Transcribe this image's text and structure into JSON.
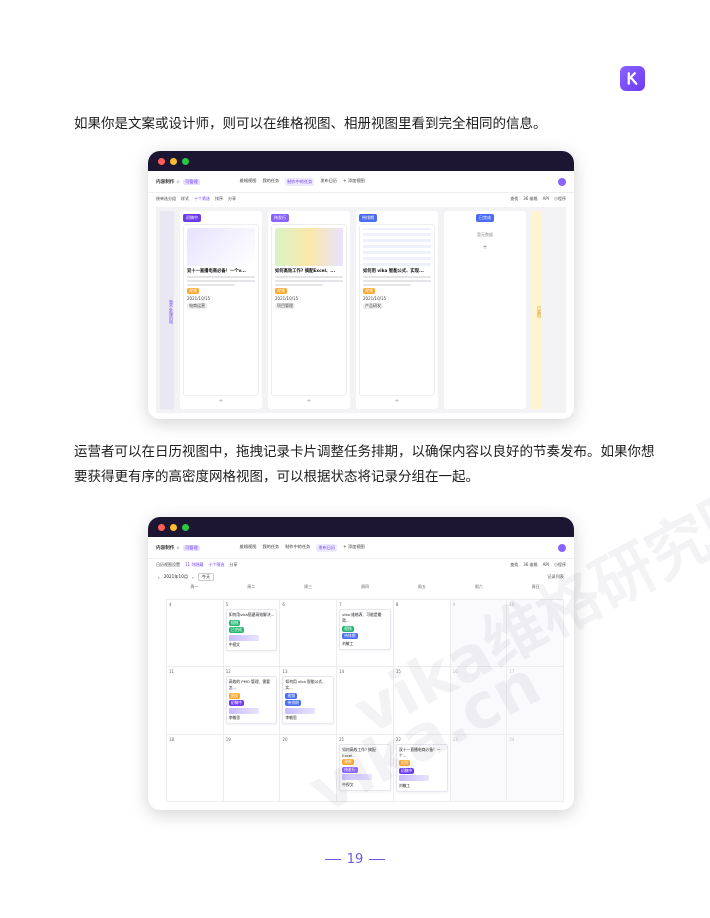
{
  "paragraphs": {
    "p1": "如果你是文案或设计师，则可以在维格视图、相册视图里看到完全相同的信息。",
    "p2": "运营者可以在日历视图中，拖拽记录卡片调整任务排期，以确保内容以良好的节奏发布。如果你想要获得更有序的高密度网格视图，可以根据状态将记录分组在一起。"
  },
  "watermark": "vika维格研究院",
  "watermark_url": "vika.cn",
  "app": {
    "name": "内容制作 ☆",
    "badge": "可管理",
    "tabs1": [
      "维格视图",
      "我的任务",
      "制作中的任务",
      "发布日历",
      "+ 添加视图"
    ],
    "tabs2": [
      "维格视图",
      "我的任务",
      "制作中的任务",
      "发布日历",
      "+ 添加视图"
    ],
    "right": [
      "查找",
      "36 维格",
      "API",
      "小程序"
    ]
  },
  "toolbar1": [
    "按单选分组",
    "样式",
    "十个筛选",
    "排序",
    "分享"
  ],
  "toolbar2": [
    "日历视图设置",
    "11 列隐藏",
    "十个筛选",
    "分享"
  ],
  "kanban": {
    "left_label": "暂不处理的项",
    "columns": [
      {
        "chip": "初稿中",
        "color": "#6b3bf2",
        "title": "双十一直播电商必备！一个v...",
        "owner": "2021/10/15",
        "tag": "视频",
        "bottom": "电商运营"
      },
      {
        "chip": "待发行",
        "color": "#8a63ff",
        "title": "如何高效工作? 搞配Excel、...",
        "owner": "2021/10/15",
        "tag": "视频",
        "bottom": "项目管理"
      },
      {
        "chip": "待排期",
        "color": "#4a6cf7",
        "title": "如何用 vika 智能公式、实现...",
        "owner": "2021/10/15",
        "tag": "视频",
        "bottom": "产品研发"
      }
    ],
    "empty_chip": "已完成",
    "empty_text": "暂无数据",
    "right_label": "已超时"
  },
  "calendar": {
    "month": "2021年10月",
    "today": "今天",
    "right": "记录列表",
    "weekdays": [
      "周一",
      "周二",
      "周三",
      "周四",
      "周五",
      "周六",
      "周日"
    ],
    "rows": [
      [
        "4",
        "5",
        "6",
        "7",
        "8",
        "9",
        "10"
      ],
      [
        "11",
        "12",
        "13",
        "14",
        "15",
        "16",
        "17"
      ],
      [
        "18",
        "19",
        "20",
        "21",
        "22",
        "23",
        "24"
      ]
    ],
    "events": [
      {
        "title": "如何用vika搭建高效解决...",
        "pill": "视频",
        "color": "#2bb673",
        "status": "已完成",
        "owner": "中视文"
      },
      {
        "title": "vika 维格表、可能是最简...",
        "pill": "视频",
        "color": "#2bb673",
        "status": "待排期",
        "owner": "刘敏工"
      },
      {
        "title": "高效的 PMO 管理、需要怎...",
        "pill": "图文",
        "color": "#ffa62b",
        "status": "初稿中",
        "owner": "李敏思"
      },
      {
        "title": "如何用 vika 智能公式、实...",
        "pill": "视频",
        "color": "#4a6cf7",
        "status": "待排期",
        "owner": "李敏思"
      },
      {
        "title": "如何高效工作? 搞配Excel...",
        "pill": "视频",
        "color": "#ffa62b",
        "status": "待发行",
        "owner": "中视文"
      },
      {
        "title": "双十一直播电商必备！一个...",
        "pill": "视频",
        "color": "#ffa62b",
        "status": "初稿中",
        "owner": "刘敏工"
      }
    ]
  },
  "page_number": "19"
}
